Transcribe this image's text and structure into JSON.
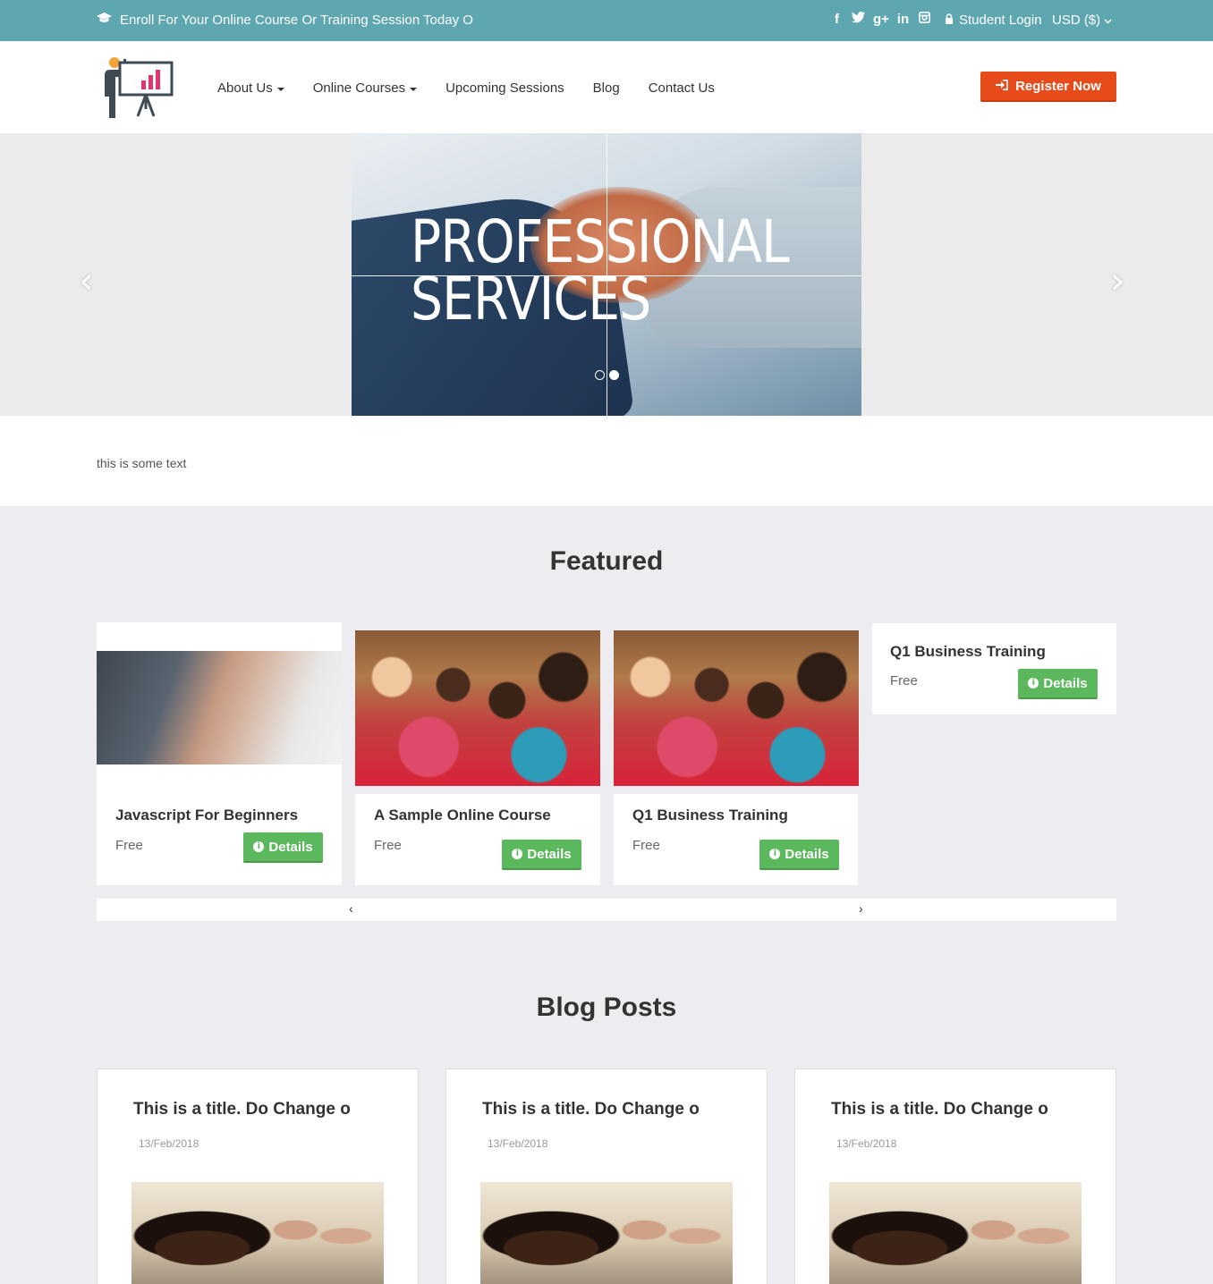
{
  "topbar": {
    "announcement": "Enroll For Your Online Course Or Training Session Today O",
    "social_icons": [
      "facebook-icon",
      "twitter-icon",
      "google-plus-icon",
      "linkedin-icon",
      "instagram-icon"
    ],
    "login_label": "Student Login",
    "currency_label": "USD ($)",
    "bg_color": "#5ea7b0"
  },
  "nav": {
    "items": [
      {
        "label": "About Us",
        "dropdown": true
      },
      {
        "label": "Online Courses",
        "dropdown": true
      },
      {
        "label": "Upcoming Sessions",
        "dropdown": false
      },
      {
        "label": "Blog",
        "dropdown": false
      },
      {
        "label": "Contact Us",
        "dropdown": false
      }
    ],
    "register_label": "Register Now",
    "register_color": "#e84b1a"
  },
  "hero": {
    "title_line1": "PROFESSIONAL",
    "title_line2": "SERVICES",
    "slides": 2,
    "active_slide": 2
  },
  "intro": {
    "text": "this is some text"
  },
  "featured": {
    "heading": "Featured",
    "details_label": "Details",
    "courses": [
      {
        "name": "Javascript For Beginners",
        "price": "Free",
        "image": "handshake"
      },
      {
        "name": "A Sample Online Course",
        "price": "Free",
        "image": "children-classroom"
      },
      {
        "name": "Q1 Business Training",
        "price": "Free",
        "image": "children-classroom"
      },
      {
        "name": "Q1 Business Training",
        "price": "Free",
        "image": "none"
      }
    ],
    "button_color": "#5cb85c",
    "prev_label": "‹",
    "next_label": "›"
  },
  "blog": {
    "heading": "Blog Posts",
    "posts": [
      {
        "title": "This is a title. Do Change o",
        "date": "13/Feb/2018"
      },
      {
        "title": "This is a title. Do Change o",
        "date": "13/Feb/2018"
      },
      {
        "title": "This is a title. Do Change o",
        "date": "13/Feb/2018"
      }
    ]
  }
}
